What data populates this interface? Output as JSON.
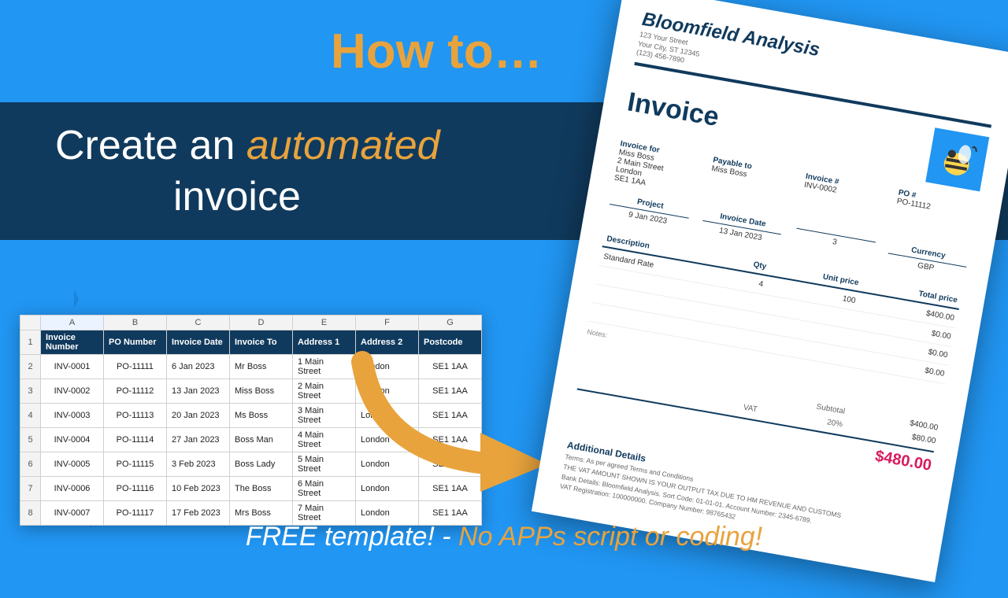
{
  "heading": {
    "kicker": "How to…",
    "line_pre": "Create an ",
    "line_accent": "automated",
    "line_post": " invoice"
  },
  "spreadsheet": {
    "cols": [
      "A",
      "B",
      "C",
      "D",
      "E",
      "F",
      "G"
    ],
    "headers": [
      "Invoice Number",
      "PO Number",
      "Invoice Date",
      "Invoice To",
      "Address 1",
      "Address 2",
      "Postcode"
    ],
    "rows": [
      [
        "INV-0001",
        "PO-11111",
        "6 Jan 2023",
        "Mr Boss",
        "1 Main Street",
        "London",
        "SE1 1AA"
      ],
      [
        "INV-0002",
        "PO-11112",
        "13 Jan 2023",
        "Miss Boss",
        "2 Main Street",
        "London",
        "SE1 1AA"
      ],
      [
        "INV-0003",
        "PO-11113",
        "20 Jan 2023",
        "Ms Boss",
        "3 Main Street",
        "London",
        "SE1 1AA"
      ],
      [
        "INV-0004",
        "PO-11114",
        "27 Jan 2023",
        "Boss Man",
        "4 Main Street",
        "London",
        "SE1 1AA"
      ],
      [
        "INV-0005",
        "PO-11115",
        "3 Feb 2023",
        "Boss Lady",
        "5 Main Street",
        "London",
        "SE1 1AA"
      ],
      [
        "INV-0006",
        "PO-11116",
        "10 Feb 2023",
        "The Boss",
        "6 Main Street",
        "London",
        "SE1 1AA"
      ],
      [
        "INV-0007",
        "PO-11117",
        "17 Feb 2023",
        "Mrs Boss",
        "7 Main Street",
        "London",
        "SE1 1AA"
      ]
    ]
  },
  "invoice": {
    "company": "Bloomfield Analysis",
    "addr1": "123 Your Street",
    "addr2": "Your City, ST 12345",
    "phone": "(123) 456-7890",
    "title": "Invoice",
    "for_label": "Invoice for",
    "for_name": "Miss Boss",
    "for_addr1": "2 Main Street",
    "for_addr2": "London",
    "for_post": "SE1 1AA",
    "payable_label": "Payable to",
    "payable_value": "Miss Boss",
    "invoice_num_label": "Invoice #",
    "invoice_num": "INV-0002",
    "po_label": "PO #",
    "po": "PO-11112",
    "project_label": "Project",
    "project": "9 Jan 2023",
    "date_label": "Invoice Date",
    "date": "13 Jan 2023",
    "due_label": "",
    "due": "3",
    "currency_label": "Currency",
    "currency": "GBP",
    "table": {
      "head": [
        "Description",
        "Qty",
        "Unit price",
        "Total price"
      ],
      "rows": [
        [
          "Standard Rate",
          "4",
          "100",
          "$400.00"
        ],
        [
          "",
          "",
          "",
          "$0.00"
        ],
        [
          "",
          "",
          "",
          "$0.00"
        ],
        [
          "",
          "",
          "",
          "$0.00"
        ]
      ]
    },
    "notes_label": "Notes:",
    "totals": {
      "subtotal_label": "Subtotal",
      "subtotal": "$400.00",
      "vat_label": "VAT",
      "vat_rate": "20%",
      "vat": "$80.00",
      "grand": "$480.00"
    },
    "details": {
      "heading": "Additional Details",
      "l1": "Terms: As per agreed Terms and Conditions",
      "l2": "THE VAT AMOUNT SHOWN IS YOUR OUTPUT TAX DUE TO HM REVENUE AND CUSTOMS",
      "l3": "Bank Details: Bloomfield Analysis. Sort Code: 01-01-01. Account Number: 2345-6789.",
      "l4": "VAT Registration: 100000000. Company Number: 98765432"
    }
  },
  "footer": {
    "part1": "FREE template! - ",
    "part2": "No APPs script or coding!"
  }
}
